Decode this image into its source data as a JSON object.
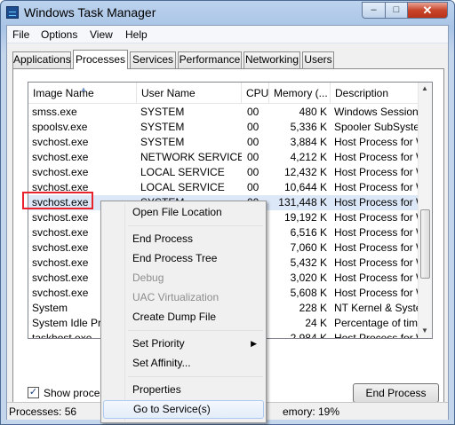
{
  "window": {
    "title": "Windows Task Manager"
  },
  "menu": [
    "File",
    "Options",
    "View",
    "Help"
  ],
  "tabs": [
    "Applications",
    "Processes",
    "Services",
    "Performance",
    "Networking",
    "Users"
  ],
  "active_tab": "Processes",
  "columns": [
    "Image Name",
    "User Name",
    "CPU",
    "Memory (...",
    "Description"
  ],
  "rows": [
    {
      "image": "smss.exe",
      "user": "SYSTEM",
      "cpu": "00",
      "mem": "480 K",
      "desc": "Windows Session M"
    },
    {
      "image": "spoolsv.exe",
      "user": "SYSTEM",
      "cpu": "00",
      "mem": "5,336 K",
      "desc": "Spooler SubSystem"
    },
    {
      "image": "svchost.exe",
      "user": "SYSTEM",
      "cpu": "00",
      "mem": "3,884 K",
      "desc": "Host Process for W"
    },
    {
      "image": "svchost.exe",
      "user": "NETWORK SERVICE",
      "cpu": "00",
      "mem": "4,212 K",
      "desc": "Host Process for W"
    },
    {
      "image": "svchost.exe",
      "user": "LOCAL SERVICE",
      "cpu": "00",
      "mem": "12,432 K",
      "desc": "Host Process for W"
    },
    {
      "image": "svchost.exe",
      "user": "LOCAL SERVICE",
      "cpu": "00",
      "mem": "10,644 K",
      "desc": "Host Process for W"
    },
    {
      "image": "svchost.exe",
      "user": "SYSTEM",
      "cpu": "00",
      "mem": "131,448 K",
      "desc": "Host Process for W"
    },
    {
      "image": "svchost.exe",
      "user": "",
      "cpu": "",
      "mem": "19,192 K",
      "desc": "Host Process for W"
    },
    {
      "image": "svchost.exe",
      "user": "",
      "cpu": "",
      "mem": "6,516 K",
      "desc": "Host Process for W"
    },
    {
      "image": "svchost.exe",
      "user": "",
      "cpu": "",
      "mem": "7,060 K",
      "desc": "Host Process for W"
    },
    {
      "image": "svchost.exe",
      "user": "",
      "cpu": "",
      "mem": "5,432 K",
      "desc": "Host Process for W"
    },
    {
      "image": "svchost.exe",
      "user": "",
      "cpu": "",
      "mem": "3,020 K",
      "desc": "Host Process for W"
    },
    {
      "image": "svchost.exe",
      "user": "",
      "cpu": "",
      "mem": "5,608 K",
      "desc": "Host Process for W"
    },
    {
      "image": "System",
      "user": "",
      "cpu": "",
      "mem": "228 K",
      "desc": "NT Kernel & System"
    },
    {
      "image": "System Idle Proc",
      "user": "",
      "cpu": "",
      "mem": "24 K",
      "desc": "Percentage of time"
    },
    {
      "image": "taskhost.exe",
      "user": "",
      "cpu": "",
      "mem": "2,984 K",
      "desc": "Host Process for W"
    }
  ],
  "selected_row_index": 6,
  "show_all_label": "Show processes",
  "show_all_checked": true,
  "end_process_label": "End Process",
  "status": {
    "processes": "Processes: 56",
    "memory": "emory: 19%"
  },
  "context_menu": {
    "open_file_location": "Open File Location",
    "end_process": "End Process",
    "end_process_tree": "End Process Tree",
    "debug": "Debug",
    "uac_virtualization": "UAC Virtualization",
    "create_dump_file": "Create Dump File",
    "set_priority": "Set Priority",
    "set_affinity": "Set Affinity...",
    "properties": "Properties",
    "go_to_services": "Go to Service(s)"
  },
  "accent_colors": {
    "highlight": "#e8232b",
    "selection": "#dce8f8",
    "close_button": "#c8452a"
  }
}
